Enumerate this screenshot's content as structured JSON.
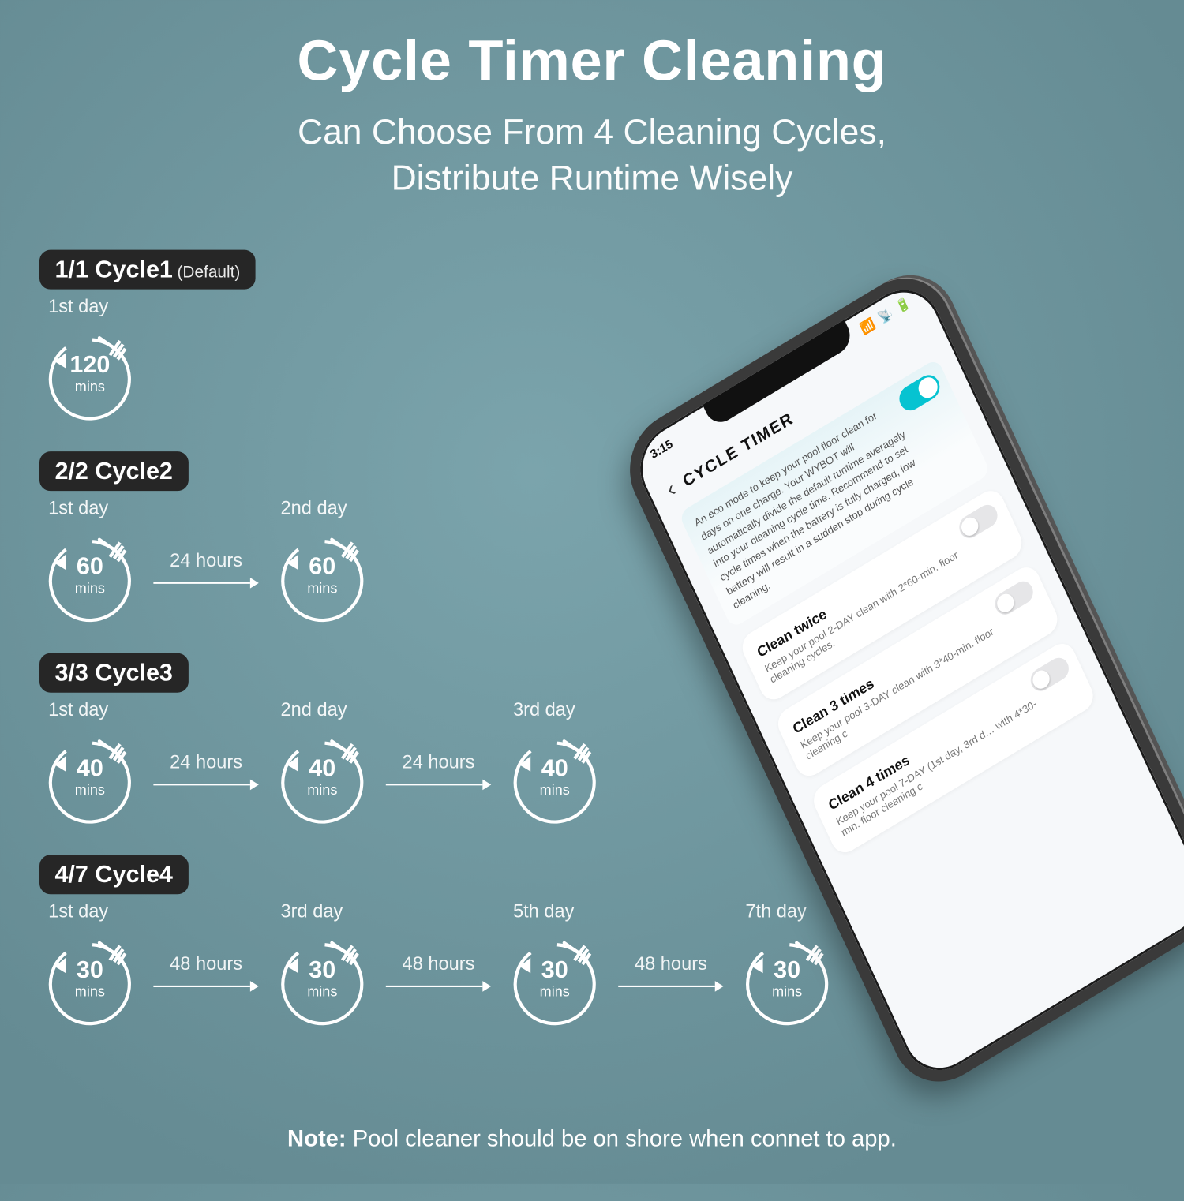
{
  "header": {
    "title": "Cycle Timer Cleaning",
    "subtitle_l1": "Can Choose From 4 Cleaning Cycles,",
    "subtitle_l2": "Distribute Runtime Wisely"
  },
  "cycles": [
    {
      "badge": "1/1 Cycle1",
      "badge_note": "(Default)",
      "stages": [
        {
          "day": "1st day",
          "mins": "120",
          "unit": "mins"
        }
      ],
      "gaps": []
    },
    {
      "badge": "2/2 Cycle2",
      "badge_note": "",
      "stages": [
        {
          "day": "1st day",
          "mins": "60",
          "unit": "mins"
        },
        {
          "day": "2nd day",
          "mins": "60",
          "unit": "mins"
        }
      ],
      "gaps": [
        "24 hours"
      ]
    },
    {
      "badge": "3/3 Cycle3",
      "badge_note": "",
      "stages": [
        {
          "day": "1st day",
          "mins": "40",
          "unit": "mins"
        },
        {
          "day": "2nd day",
          "mins": "40",
          "unit": "mins"
        },
        {
          "day": "3rd day",
          "mins": "40",
          "unit": "mins"
        }
      ],
      "gaps": [
        "24 hours",
        "24 hours"
      ]
    },
    {
      "badge": "4/7 Cycle4",
      "badge_note": "",
      "stages": [
        {
          "day": "1st day",
          "mins": "30",
          "unit": "mins"
        },
        {
          "day": "3rd day",
          "mins": "30",
          "unit": "mins"
        },
        {
          "day": "5th day",
          "mins": "30",
          "unit": "mins"
        },
        {
          "day": "7th day",
          "mins": "30",
          "unit": "mins"
        }
      ],
      "gaps": [
        "48 hours",
        "48 hours",
        "48 hours"
      ]
    }
  ],
  "footer": {
    "label": "Note:",
    "text": " Pool cleaner should be on shore when connet to app."
  },
  "phone": {
    "status_time": "3:15",
    "status_glyphs": "📶 📡 🔋",
    "back": "‹",
    "title": "CYCLE TIMER",
    "desc": "An eco mode to keep your pool floor clean for days on one charge. Your WYBOT will automatically divide the default runtime averagely into your cleaning cycle time. Recommend to set cycle times when the battery is fully charged, low battery will result in a sudden stop during cycle cleaning.",
    "options": [
      {
        "title": "Clean twice",
        "desc": "Keep your pool 2-DAY clean with 2*60-min. floor cleaning cycles."
      },
      {
        "title": "Clean 3 times",
        "desc": "Keep your pool 3-DAY clean with 3*40-min. floor cleaning c"
      },
      {
        "title": "Clean 4 times",
        "desc": "Keep your pool 7-DAY (1st day, 3rd d… with 4*30-min. floor cleaning c"
      }
    ]
  }
}
